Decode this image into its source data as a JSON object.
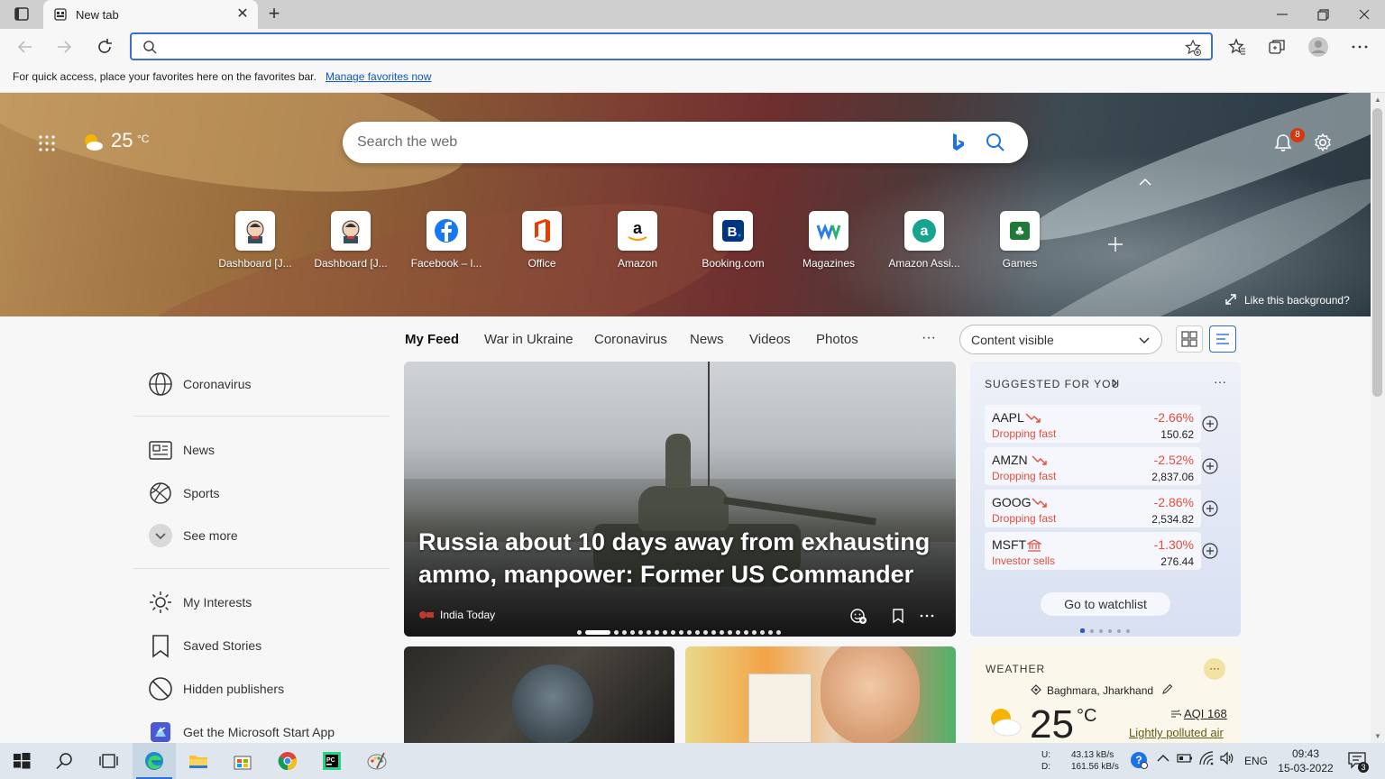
{
  "browser": {
    "tab_title": "New tab",
    "address_placeholder": "",
    "favorites_bar_message": "For quick access, place your favorites here on the favorites bar.",
    "favorites_bar_link": "Manage favorites now"
  },
  "hero": {
    "weather_temp": "25",
    "weather_unit": "°C",
    "search_placeholder": "Search the web",
    "notification_count": "8",
    "like_background": "Like this background?",
    "quick_links": [
      {
        "label": "Dashboard [J...",
        "icon": "jenkins-icon"
      },
      {
        "label": "Dashboard [J...",
        "icon": "jenkins-icon"
      },
      {
        "label": "Facebook – l...",
        "icon": "facebook-icon"
      },
      {
        "label": "Office",
        "icon": "office-icon"
      },
      {
        "label": "Amazon",
        "icon": "amazon-icon"
      },
      {
        "label": "Booking.com",
        "icon": "booking-icon"
      },
      {
        "label": "Magazines",
        "icon": "magazines-icon"
      },
      {
        "label": "Amazon Assi...",
        "icon": "amazon-assistant-icon"
      },
      {
        "label": "Games",
        "icon": "games-icon"
      }
    ]
  },
  "feed_nav": {
    "tabs": [
      "My Feed",
      "War in Ukraine",
      "Coronavirus",
      "News",
      "Videos",
      "Photos"
    ],
    "more": "···",
    "content_dropdown": "Content visible"
  },
  "sidebar": {
    "items": [
      {
        "label": "Coronavirus",
        "icon": "globe-icon"
      },
      {
        "label": "News",
        "icon": "newspaper-icon"
      },
      {
        "label": "Sports",
        "icon": "sports-icon"
      },
      {
        "label": "See more",
        "icon": "chevron-down-icon"
      },
      {
        "label": "My Interests",
        "icon": "sun-icon"
      },
      {
        "label": "Saved Stories",
        "icon": "bookmark-icon"
      },
      {
        "label": "Hidden publishers",
        "icon": "block-icon"
      },
      {
        "label": "Get the Microsoft Start App",
        "icon": "microsoft-start-icon"
      }
    ]
  },
  "top_story": {
    "headline": "Russia about 10 days away from exhausting ammo, manpower: Former US Commander",
    "publisher": "India Today"
  },
  "watchlist": {
    "header": "SUGGESTED FOR YOU",
    "more": "···",
    "stocks": [
      {
        "symbol": "AAPL",
        "change": "-2.66%",
        "price": "150.62",
        "status": "Dropping fast"
      },
      {
        "symbol": "AMZN",
        "change": "-2.52%",
        "price": "2,837.06",
        "status": "Dropping fast"
      },
      {
        "symbol": "GOOG",
        "change": "-2.86%",
        "price": "2,534.82",
        "status": "Dropping fast"
      },
      {
        "symbol": "MSFT",
        "change": "-1.30%",
        "price": "276.44",
        "status": "Investor sells"
      }
    ],
    "cta": "Go to watchlist"
  },
  "weather_card": {
    "header": "WEATHER",
    "more": "···",
    "location": "Baghmara, Jharkhand",
    "temp": "25",
    "unit": "°C",
    "aqi": "AQI 168",
    "aqi_desc": "Lightly polluted air"
  },
  "taskbar": {
    "net_up_label": "U:",
    "net_up": "43.13 kB/s",
    "net_down_label": "D:",
    "net_down": "161.56 kB/s",
    "language": "ENG",
    "time": "09:43",
    "date": "15-03-2022",
    "notification_count": "3"
  }
}
